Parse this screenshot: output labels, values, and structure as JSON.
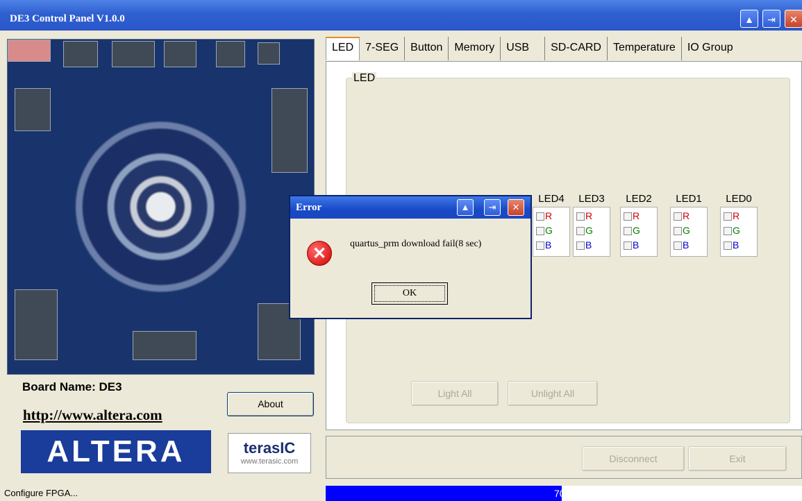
{
  "window": {
    "title": "DE3 Control Panel V1.0.0",
    "minimize_glyph": "▲",
    "restore_glyph": "⇥",
    "close_glyph": "✕"
  },
  "left": {
    "board_name": "Board Name: DE3",
    "url": "http://www.altera.com",
    "about_label": "About",
    "altera_logo_text": "ALTERA",
    "terasic_logo_text": "terasIC",
    "terasic_url": "www.terasic.com"
  },
  "tabs": [
    "LED",
    "7-SEG",
    "Button",
    "Memory",
    "USB",
    "SD-CARD",
    "Temperature",
    "IO Group"
  ],
  "led_panel": {
    "group_label": "LED",
    "leds": [
      {
        "name": "LED4"
      },
      {
        "name": "LED3"
      },
      {
        "name": "LED2"
      },
      {
        "name": "LED1"
      },
      {
        "name": "LED0"
      }
    ],
    "channels": [
      "R",
      "G",
      "B"
    ],
    "channel_colors": {
      "R": "#cc0000",
      "G": "#008000",
      "B": "#0000cc"
    },
    "light_all_label": "Light All",
    "unlight_all_label": "Unlight All"
  },
  "footer": {
    "disconnect_label": "Disconnect",
    "exit_label": "Exit"
  },
  "status": {
    "text": "Configure FPGA...",
    "progress_percent": 70,
    "progress_label": "70%"
  },
  "dialog": {
    "title": "Error",
    "message": "quartus_prm download fail(8 sec)",
    "ok_label": "OK",
    "icon": "error-x-icon"
  }
}
